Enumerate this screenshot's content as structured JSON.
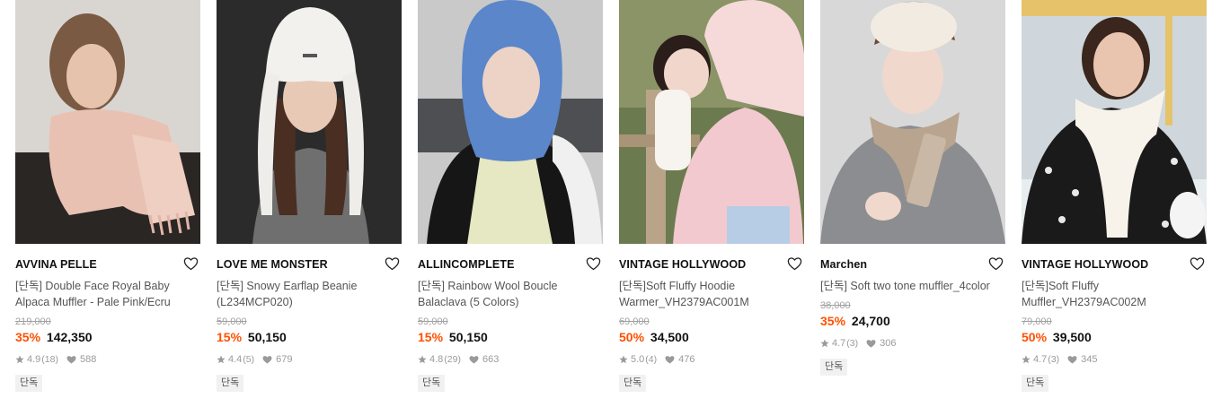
{
  "products": [
    {
      "brand": "AVVINA PELLE",
      "name": "[단독] Double Face Royal Baby Alpaca Muffler - Pale Pink/Ecru",
      "original_price": "219,000",
      "discount": "35%",
      "price": "142,350",
      "rating": "4.9",
      "review_count": "(18)",
      "likes": "588",
      "badge": "단독"
    },
    {
      "brand": "LOVE ME MONSTER",
      "name": "[단독] Snowy Earflap Beanie (L234MCP020)",
      "original_price": "59,000",
      "discount": "15%",
      "price": "50,150",
      "rating": "4.4",
      "review_count": "(5)",
      "likes": "679",
      "badge": "단독"
    },
    {
      "brand": "ALLINCOMPLETE",
      "name": "[단독] Rainbow Wool Boucle Balaclava (5 Colors)",
      "original_price": "59,000",
      "discount": "15%",
      "price": "50,150",
      "rating": "4.8",
      "review_count": "(29)",
      "likes": "663",
      "badge": "단독"
    },
    {
      "brand": "VINTAGE HOLLYWOOD",
      "name": "[단독]Soft Fluffy Hoodie Warmer_VH2379AC001M",
      "original_price": "69,000",
      "discount": "50%",
      "price": "34,500",
      "rating": "5.0",
      "review_count": "(4)",
      "likes": "476",
      "badge": "단독"
    },
    {
      "brand": "Marchen",
      "name": "[단독] Soft two tone muffler_4color",
      "original_price": "38,000",
      "discount": "35%",
      "price": "24,700",
      "rating": "4.7",
      "review_count": "(3)",
      "likes": "306",
      "badge": "단독"
    },
    {
      "brand": "VINTAGE HOLLYWOOD",
      "name": "[단독]Soft Fluffy Muffler_VH2379AC002M",
      "original_price": "79,000",
      "discount": "50%",
      "price": "39,500",
      "rating": "4.7",
      "review_count": "(3)",
      "likes": "345",
      "badge": "단독"
    }
  ],
  "colors": {
    "discount": "#ff5000",
    "meta_gray": "#9a9a9a",
    "badge_bg": "#f1f1f1"
  },
  "icons": {
    "wishlist": "heart-outline-icon",
    "rating": "star-icon",
    "likes": "heart-filled-icon"
  }
}
